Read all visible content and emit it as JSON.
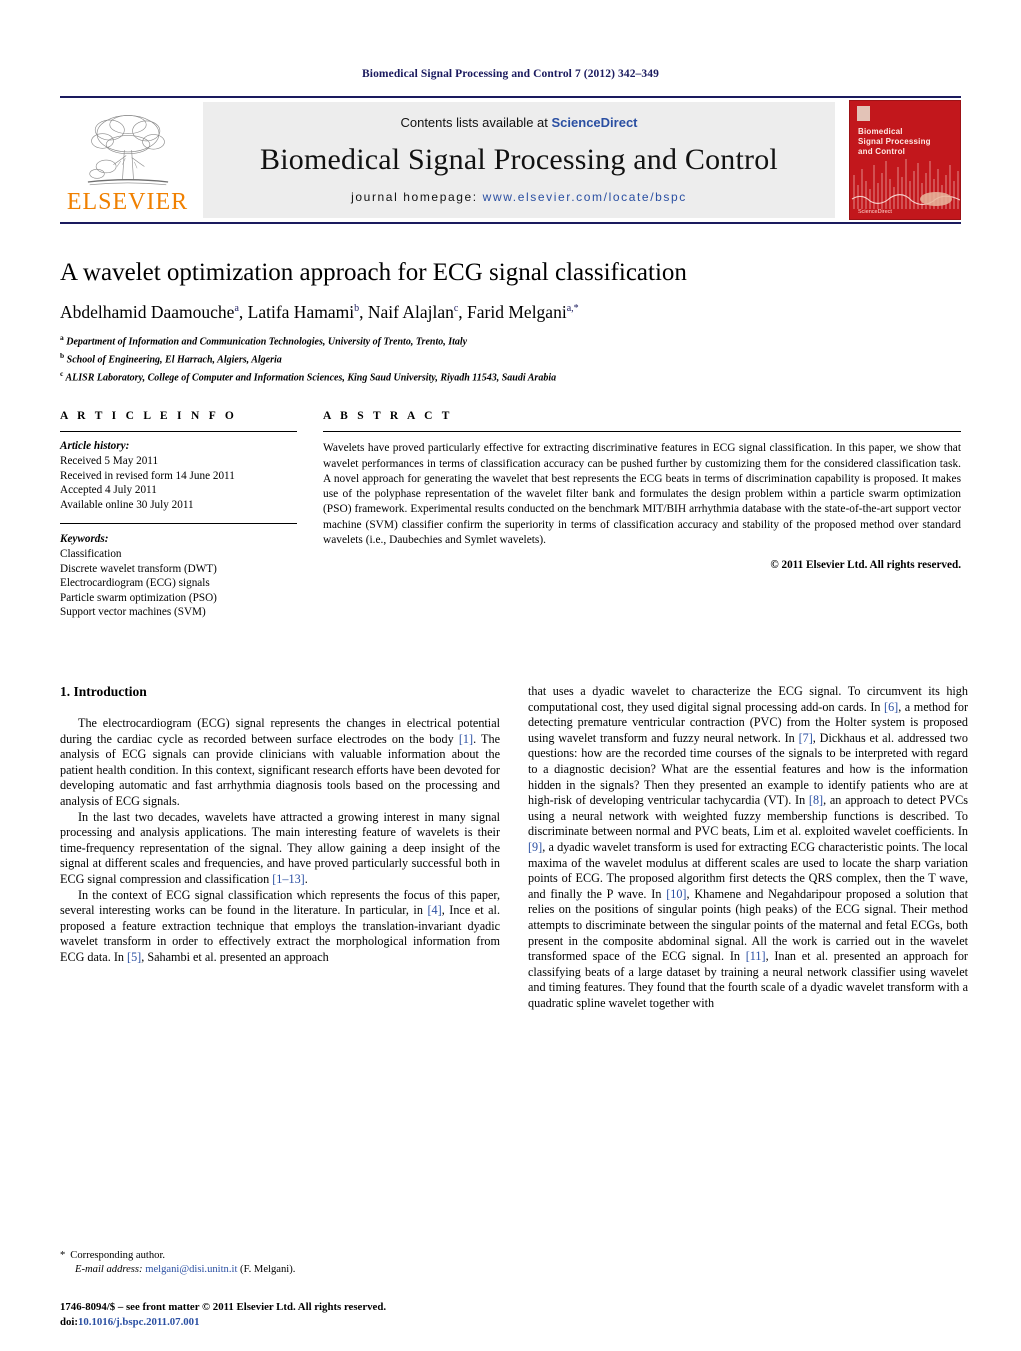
{
  "running_head": "Biomedical Signal Processing and Control 7 (2012) 342–349",
  "masthead": {
    "publisher_logo_text": "ELSEVIER",
    "contents_prefix": "Contents lists available at",
    "contents_link": "ScienceDirect",
    "journal_title": "Biomedical Signal Processing and Control",
    "homepage_prefix": "journal homepage:",
    "homepage_url": "www.elsevier.com/locate/bspc",
    "cover": {
      "title_lines": [
        "Biomedical",
        "Signal Processing",
        "and Control"
      ],
      "footer_text": "ScienceDirect",
      "background_color": "#c2171c"
    },
    "accent_color": "#1a1a5e",
    "link_color": "#2a4fa2",
    "elsevier_orange": "#f08000"
  },
  "article": {
    "title": "A wavelet optimization approach for ECG signal classification",
    "authors": [
      {
        "name": "Abdelhamid Daamouche",
        "marks": "a"
      },
      {
        "name": "Latifa Hamami",
        "marks": "b"
      },
      {
        "name": "Naif Alajlan",
        "marks": "c"
      },
      {
        "name": "Farid Melgani",
        "marks": "a,*"
      }
    ],
    "affiliations": [
      {
        "mark": "a",
        "text": "Department of Information and Communication Technologies, University of Trento, Trento, Italy"
      },
      {
        "mark": "b",
        "text": "School of Engineering, El Harrach, Algiers, Algeria"
      },
      {
        "mark": "c",
        "text": "ALISR Laboratory, College of Computer and Information Sciences, King Saud University, Riyadh 11543, Saudi Arabia"
      }
    ]
  },
  "article_info": {
    "heading": "A R T I C L E   I N F O",
    "history_label": "Article history:",
    "history": [
      "Received 5 May 2011",
      "Received in revised form 14 June 2011",
      "Accepted 4 July 2011",
      "Available online 30 July 2011"
    ],
    "keywords_label": "Keywords:",
    "keywords": [
      "Classification",
      "Discrete wavelet transform (DWT)",
      "Electrocardiogram (ECG) signals",
      "Particle swarm optimization (PSO)",
      "Support vector machines (SVM)"
    ]
  },
  "abstract": {
    "heading": "A B S T R A C T",
    "text": "Wavelets have proved particularly effective for extracting discriminative features in ECG signal classification. In this paper, we show that wavelet performances in terms of classification accuracy can be pushed further by customizing them for the considered classification task. A novel approach for generating the wavelet that best represents the ECG beats in terms of discrimination capability is proposed. It makes use of the polyphase representation of the wavelet filter bank and formulates the design problem within a particle swarm optimization (PSO) framework. Experimental results conducted on the benchmark MIT/BIH arrhythmia database with the state-of-the-art support vector machine (SVM) classifier confirm the superiority in terms of classification accuracy and stability of the proposed method over standard wavelets (i.e., Daubechies and Symlet wavelets).",
    "copyright": "© 2011 Elsevier Ltd. All rights reserved."
  },
  "introduction": {
    "heading": "1.  Introduction",
    "left_paragraphs": [
      "The electrocardiogram (ECG) signal represents the changes in electrical potential during the cardiac cycle as recorded between surface electrodes on the body [1]. The analysis of ECG signals can provide clinicians with valuable information about the patient health condition. In this context, significant research efforts have been devoted for developing automatic and fast arrhythmia diagnosis tools based on the processing and analysis of ECG signals.",
      "In the last two decades, wavelets have attracted a growing interest in many signal processing and analysis applications. The main interesting feature of wavelets is their time-frequency representation of the signal. They allow gaining a deep insight of the signal at different scales and frequencies, and have proved particularly successful both in ECG signal compression and classification [1–13].",
      "In the context of ECG signal classification which represents the focus of this paper, several interesting works can be found in the literature. In particular, in [4], Ince et al. proposed a feature extraction technique that employs the translation-invariant dyadic wavelet transform in order to effectively extract the morphological information from ECG data. In [5], Sahambi et al. presented an approach"
    ],
    "right_paragraphs": [
      "that uses a dyadic wavelet to characterize the ECG signal. To circumvent its high computational cost, they used digital signal processing add-on cards. In [6], a method for detecting premature ventricular contraction (PVC) from the Holter system is proposed using wavelet transform and fuzzy neural network. In [7], Dickhaus et al. addressed two questions: how are the recorded time courses of the signals to be interpreted with regard to a diagnostic decision? What are the essential features and how is the information hidden in the signals? Then they presented an example to identify patients who are at high-risk of developing ventricular tachycardia (VT). In [8], an approach to detect PVCs using a neural network with weighted fuzzy membership functions is described. To discriminate between normal and PVC beats, Lim et al. exploited wavelet coefficients. In [9], a dyadic wavelet transform is used for extracting ECG characteristic points. The local maxima of the wavelet modulus at different scales are used to locate the sharp variation points of ECG. The proposed algorithm first detects the QRS complex, then the T wave, and finally the P wave. In [10], Khamene and Negahdaripour proposed a solution that relies on the positions of singular points (high peaks) of the ECG signal. Their method attempts to discriminate between the singular points of the maternal and fetal ECGs, both present in the composite abdominal signal. All the work is carried out in the wavelet transformed space of the ECG signal. In [11], Inan et al. presented an approach for classifying beats of a large dataset by training a neural network classifier using wavelet and timing features. They found that the fourth scale of a dyadic wavelet transform with a quadratic spline wavelet together with"
    ]
  },
  "footnote": {
    "corresponding_marker": "*",
    "corresponding_text": "Corresponding author.",
    "email_label": "E-mail address:",
    "email": "melgani@disi.unitn.it",
    "email_owner": "(F. Melgani)."
  },
  "issn_line": {
    "text": "1746-8094/$ – see front matter © 2011 Elsevier Ltd. All rights reserved.",
    "doi_label": "doi:",
    "doi": "10.1016/j.bspc.2011.07.001"
  }
}
